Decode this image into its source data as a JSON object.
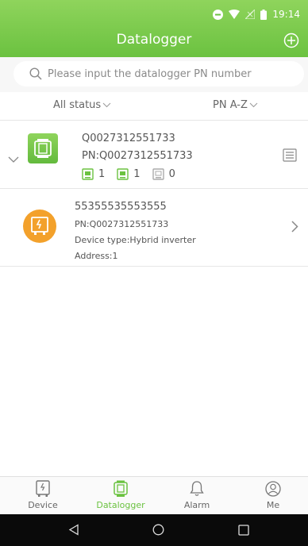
{
  "status_bar": {
    "time": "19:14"
  },
  "header": {
    "title": "Datalogger"
  },
  "search": {
    "placeholder": "Please input the datalogger PN number"
  },
  "filters": {
    "status": "All status",
    "sort": "PN A-Z"
  },
  "datalogger": {
    "name": "Q0027312551733",
    "pn": "PN:Q0027312551733",
    "counts": [
      "1",
      "1",
      "0"
    ]
  },
  "device": {
    "name": "55355535553555",
    "pn": "PN:Q0027312551733",
    "type": "Device type:Hybrid inverter",
    "address": "Address:1"
  },
  "tabs": [
    {
      "label": "Device"
    },
    {
      "label": "Datalogger"
    },
    {
      "label": "Alarm"
    },
    {
      "label": "Me"
    }
  ],
  "colors": {
    "primary": "#6bc240",
    "device_orange": "#f3a12b"
  }
}
